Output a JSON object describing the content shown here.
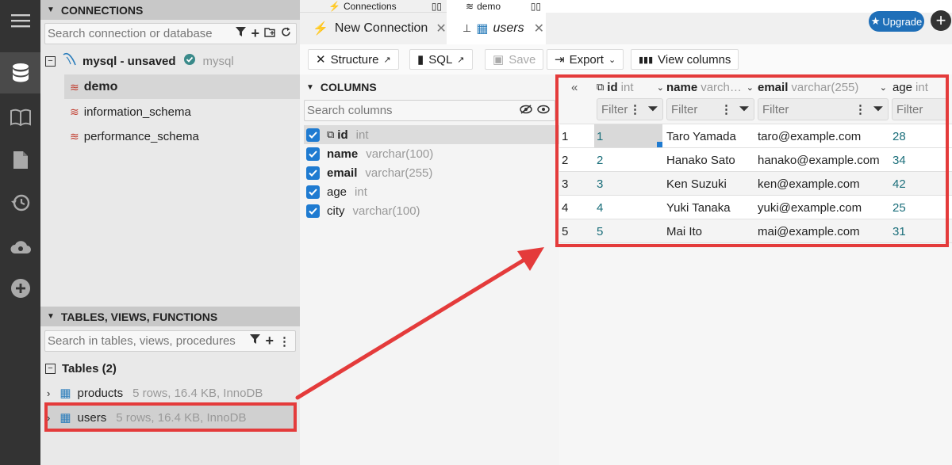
{
  "rail": {
    "icons": [
      "menu-icon",
      "database-icon",
      "book-icon",
      "document-icon",
      "history-icon",
      "cloud-icon",
      "add-icon"
    ]
  },
  "connections": {
    "header": "CONNECTIONS",
    "search_placeholder": "Search connection or database",
    "connection_name": "mysql - unsaved",
    "connection_type": "mysql",
    "databases": [
      "demo",
      "information_schema",
      "performance_schema"
    ]
  },
  "objects": {
    "header": "TABLES, VIEWS, FUNCTIONS",
    "search_placeholder": "Search in tables, views, procedures",
    "tables_label": "Tables (2)",
    "tables": [
      {
        "name": "products",
        "info": "5 rows, 16.4 KB, InnoDB"
      },
      {
        "name": "users",
        "info": "5 rows, 16.4 KB, InnoDB"
      }
    ]
  },
  "topbar": {
    "connections_label": "Connections",
    "demo_label": "demo"
  },
  "tabs": {
    "new_connection": "New Connection",
    "users": "users"
  },
  "upgrade_label": "Upgrade",
  "toolbar": {
    "structure": "Structure",
    "sql": "SQL",
    "save": "Save",
    "export": "Export",
    "view_columns": "View columns"
  },
  "columns_panel": {
    "header": "COLUMNS",
    "search_placeholder": "Search columns",
    "columns": [
      {
        "name": "id",
        "type": "int",
        "checked": true
      },
      {
        "name": "name",
        "type": "varchar(100)",
        "checked": true
      },
      {
        "name": "email",
        "type": "varchar(255)",
        "checked": true
      },
      {
        "name": "age",
        "type": "int",
        "checked": true
      },
      {
        "name": "city",
        "type": "varchar(100)",
        "checked": true
      }
    ]
  },
  "grid": {
    "collapse_label": "«",
    "headers": [
      {
        "name": "id",
        "type": "int"
      },
      {
        "name": "name",
        "type": "varch…"
      },
      {
        "name": "email",
        "type": "varchar(255)"
      },
      {
        "name": "age",
        "type": "int"
      }
    ],
    "filter_placeholder": "Filter",
    "rows": [
      {
        "n": "1",
        "id": "1",
        "name": "Taro Yamada",
        "email": "taro@example.com",
        "age": "28"
      },
      {
        "n": "2",
        "id": "2",
        "name": "Hanako Sato",
        "email": "hanako@example.com",
        "age": "34"
      },
      {
        "n": "3",
        "id": "3",
        "name": "Ken Suzuki",
        "email": "ken@example.com",
        "age": "42"
      },
      {
        "n": "4",
        "id": "4",
        "name": "Yuki Tanaka",
        "email": "yuki@example.com",
        "age": "25"
      },
      {
        "n": "5",
        "id": "5",
        "name": "Mai Ito",
        "email": "mai@example.com",
        "age": "31"
      }
    ]
  },
  "colors": {
    "accent": "#1f7bd1",
    "highlight": "#e43b3b",
    "db_icon": "#c0392b",
    "number": "#1a6e7a"
  }
}
